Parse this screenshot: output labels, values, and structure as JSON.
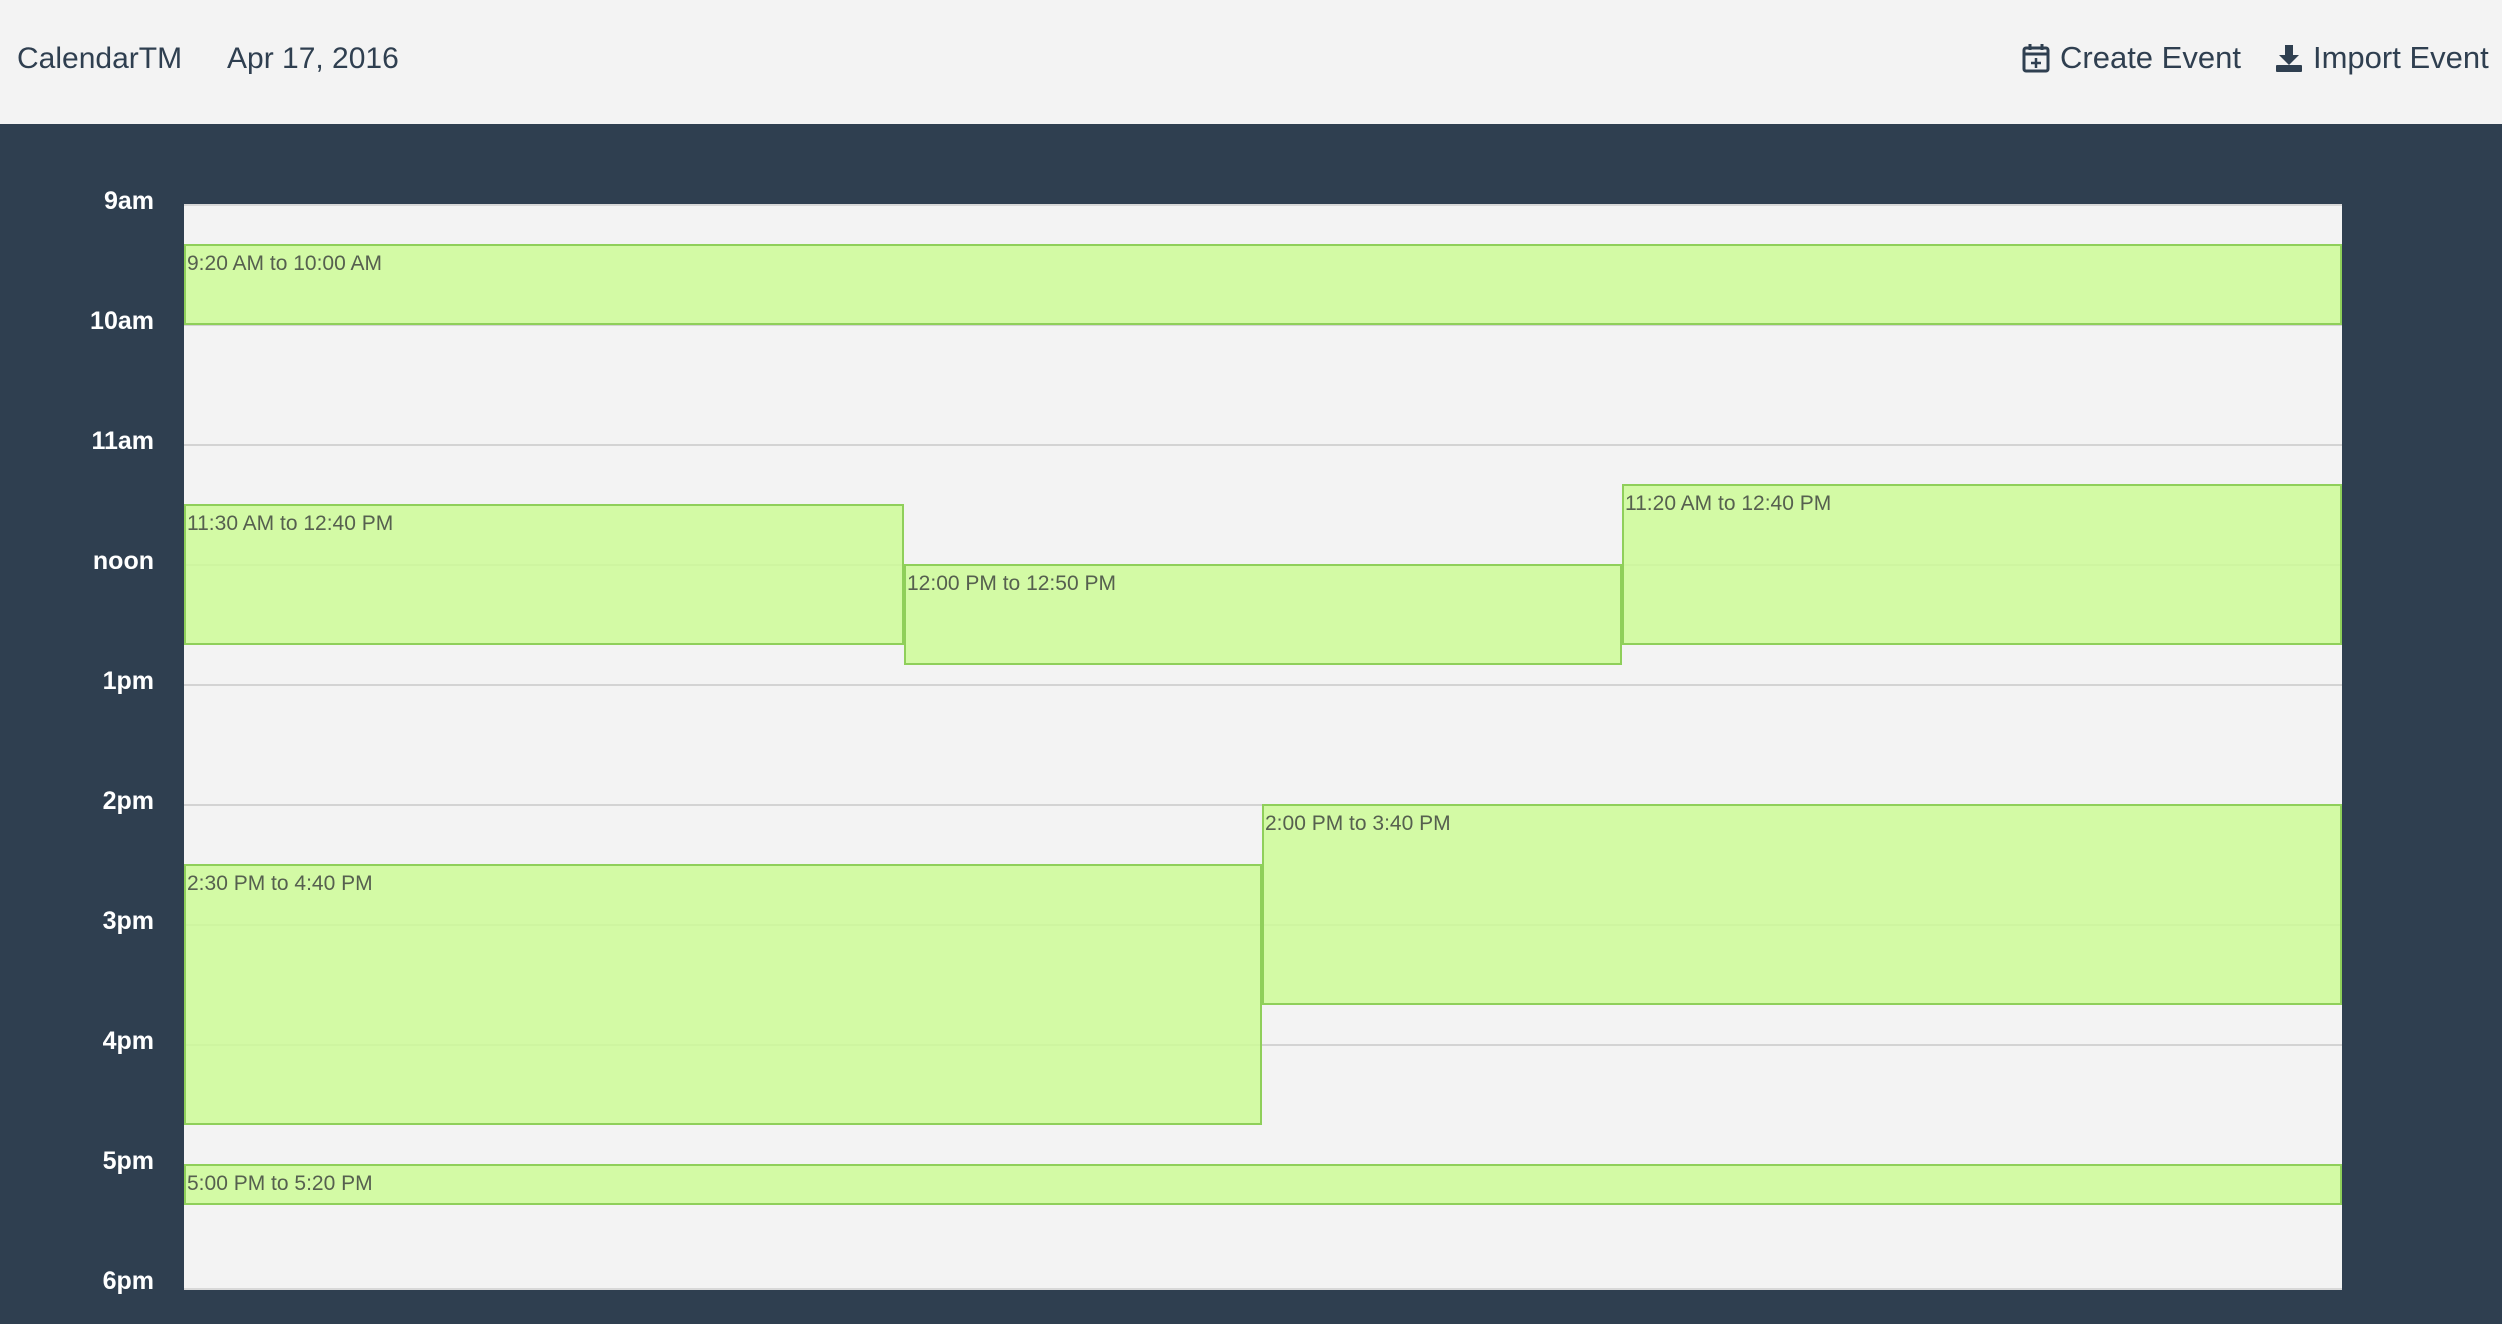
{
  "header": {
    "brand": "CalendarTM",
    "date": "Apr 17, 2016",
    "create_label": "Create Event",
    "import_label": "Import Event"
  },
  "timeline": {
    "hours": [
      "9am",
      "10am",
      "11am",
      "noon",
      "1pm",
      "2pm",
      "3pm",
      "4pm",
      "5pm",
      "6pm"
    ]
  },
  "events": [
    {
      "label": "9:20 AM to 10:00 AM"
    },
    {
      "label": "11:30 AM to 12:40 PM"
    },
    {
      "label": "12:00 PM to 12:50 PM"
    },
    {
      "label": "11:20 AM to 12:40 PM"
    },
    {
      "label": "2:30 PM to 4:40 PM"
    },
    {
      "label": "2:00 PM to 3:40 PM"
    },
    {
      "label": "5:00 PM to 5:20 PM"
    }
  ],
  "colors": {
    "header_bg": "#f3f3f3",
    "body_bg": "#2f3f50",
    "event_fill": "#d3f9a3",
    "event_border": "#8fcf5a"
  },
  "icons": {
    "create": "calendar-plus-icon",
    "import": "download-icon"
  }
}
